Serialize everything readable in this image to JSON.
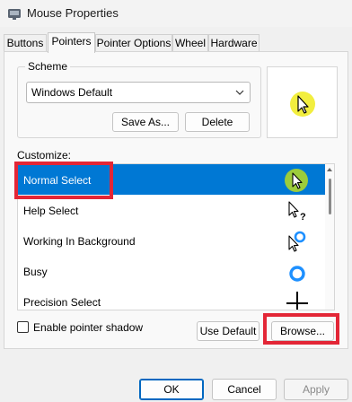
{
  "window": {
    "title": "Mouse Properties"
  },
  "tabs": [
    {
      "label": "Buttons",
      "active": false
    },
    {
      "label": "Pointers",
      "active": true
    },
    {
      "label": "Pointer Options",
      "active": false
    },
    {
      "label": "Wheel",
      "active": false
    },
    {
      "label": "Hardware",
      "active": false
    }
  ],
  "scheme": {
    "legend": "Scheme",
    "selected": "Windows Default",
    "save_as_label": "Save As...",
    "delete_label": "Delete"
  },
  "customize": {
    "label": "Customize:",
    "items": [
      {
        "label": "Normal Select",
        "selected": true,
        "icon": "normal-select-cursor-icon"
      },
      {
        "label": "Help Select",
        "selected": false,
        "icon": "help-select-cursor-icon"
      },
      {
        "label": "Working In Background",
        "selected": false,
        "icon": "working-background-cursor-icon"
      },
      {
        "label": "Busy",
        "selected": false,
        "icon": "busy-cursor-icon"
      },
      {
        "label": "Precision Select",
        "selected": false,
        "icon": "precision-select-cursor-icon"
      }
    ]
  },
  "options": {
    "shadow_label": "Enable pointer shadow",
    "shadow_checked": false,
    "use_default_label": "Use Default",
    "browse_label": "Browse..."
  },
  "dialog_buttons": {
    "ok_label": "OK",
    "cancel_label": "Cancel",
    "apply_label": "Apply"
  },
  "colors": {
    "selection": "#0078d4",
    "cursor_highlight": "#f2ee3f",
    "annotation": "#e32636",
    "busy_ring": "#1e90ff"
  }
}
